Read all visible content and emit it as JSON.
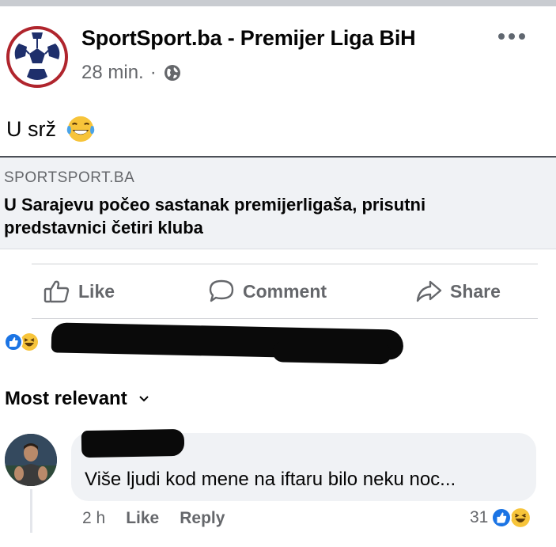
{
  "post": {
    "page_name": "SportSport.ba - Premijer Liga BiH",
    "time": "28 min.",
    "separator": "·",
    "text": "U srž",
    "avatar_icon": "football-logo-icon",
    "privacy_icon": "globe-icon",
    "more_icon": "more-options-icon"
  },
  "link": {
    "domain": "SPORTSPORT.BA",
    "title": "U Sarajevu počeo sastanak premijerligaša, prisutni predstavnici četiri kluba"
  },
  "actions": {
    "like": "Like",
    "comment": "Comment",
    "share": "Share"
  },
  "reactions": {
    "icons": [
      "like-reaction-icon",
      "haha-reaction-icon"
    ],
    "names_redacted": true
  },
  "comments_section": {
    "sort_label": "Most relevant",
    "comments": [
      {
        "author_redacted": true,
        "text": "Više ljudi kod mene na iftaru bilo neku noc...",
        "time": "2 h",
        "like_label": "Like",
        "reply_label": "Reply",
        "reaction_count": "31"
      }
    ]
  },
  "colors": {
    "text_primary": "#050505",
    "text_secondary": "#65676b",
    "like_blue": "#1b74e4",
    "card_bg": "#f0f2f5",
    "logo_red": "#b0252d",
    "logo_navy": "#1e2f6b"
  }
}
